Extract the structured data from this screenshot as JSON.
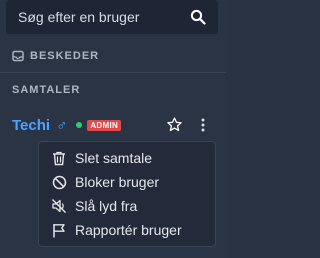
{
  "search": {
    "placeholder": "Søg efter en bruger",
    "icon": "search-icon"
  },
  "messages_section": {
    "label": "BESKEDER",
    "icon": "inbox-icon"
  },
  "conversations_section": {
    "label": "SAMTALER"
  },
  "user": {
    "name": "Techi",
    "gender_symbol": "♂",
    "status": "online",
    "badge": "ADMIN",
    "colors": {
      "name": "#4aa3ff",
      "online": "#2ecc71",
      "badge": "#e54848"
    }
  },
  "context_menu": {
    "items": [
      {
        "label": "Slet samtale",
        "icon": "trash-icon"
      },
      {
        "label": "Bloker bruger",
        "icon": "block-icon"
      },
      {
        "label": "Slå lyd fra",
        "icon": "mute-icon"
      },
      {
        "label": "Rapportér bruger",
        "icon": "flag-icon"
      }
    ]
  }
}
